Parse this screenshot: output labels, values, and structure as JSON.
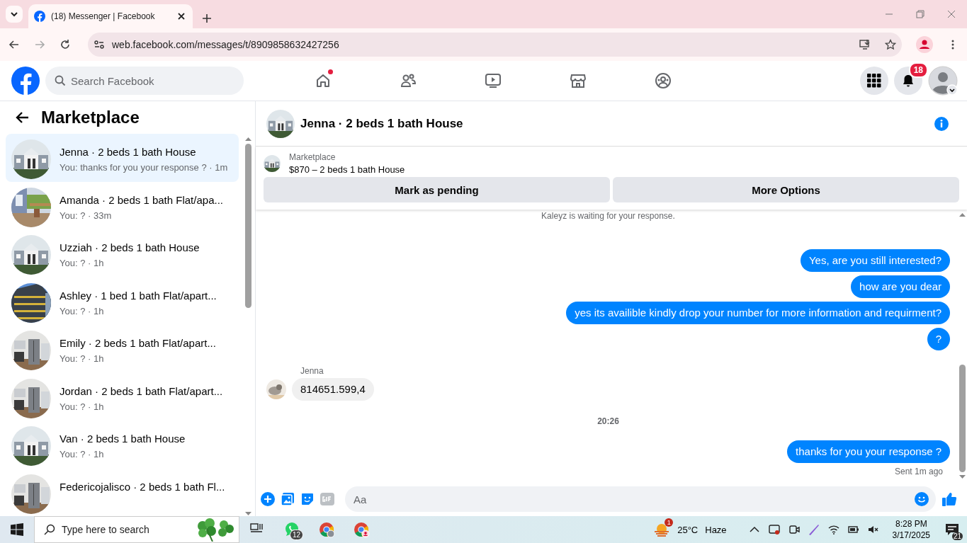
{
  "browser": {
    "tab": {
      "title": "(18) Messenger | Facebook"
    },
    "address": "web.facebook.com/messages/t/8909858632427256"
  },
  "topbar": {
    "search": {
      "placeholder": "Search Facebook"
    },
    "nav": [
      {
        "kind": "home",
        "dot": true
      },
      {
        "kind": "friends",
        "dot": false
      },
      {
        "kind": "video",
        "dot": false
      },
      {
        "kind": "marketplace",
        "dot": false
      },
      {
        "kind": "groups",
        "dot": false
      }
    ],
    "notification_count": "18"
  },
  "sidebar": {
    "title": "Marketplace",
    "conversations": [
      {
        "title": "Jenna · 2 beds 1 bath House",
        "preview": "You: thanks for you your response ? · 1m",
        "selected": true
      },
      {
        "title": "Amanda · 2 beds 1 bath Flat/apa...",
        "preview": "You: ? · 33m",
        "selected": false
      },
      {
        "title": "Uzziah · 2 beds 1 bath House",
        "preview": "You: ? · 1h",
        "selected": false
      },
      {
        "title": "Ashley · 1 bed 1 bath Flat/apart...",
        "preview": "You: ? · 1h",
        "selected": false
      },
      {
        "title": "Emily · 2 beds 1 bath Flat/apart...",
        "preview": "You: ? · 1h",
        "selected": false
      },
      {
        "title": "Jordan · 2 beds 1 bath Flat/apart...",
        "preview": "You: ? · 1h",
        "selected": false
      },
      {
        "title": "Van · 2 beds 1 bath House",
        "preview": "You: ? · 1h",
        "selected": false
      },
      {
        "title": "Federicojalisco · 2 beds 1 bath Fl...",
        "selected": false
      }
    ]
  },
  "chat": {
    "title": "Jenna · 2 beds 1 bath House",
    "listing": {
      "label": "Marketplace",
      "price": "$870 – 2 beds 1 bath House"
    },
    "buttons": [
      "Mark as pending",
      "More Options"
    ],
    "notice": "Kaleyz is waiting for your response.",
    "messages": [
      {
        "kind": "sent",
        "text": "Yes, are you still interested?"
      },
      {
        "kind": "sent",
        "text": "how are you dear"
      },
      {
        "kind": "sent",
        "text": "yes its availible kindly drop your number for more information and requirment?"
      },
      {
        "kind": "sent",
        "text": "?"
      },
      {
        "kind": "received",
        "sender": "Jenna",
        "text": "814651.599,4"
      },
      {
        "kind": "time",
        "text": "20:26"
      },
      {
        "kind": "sent",
        "text": "thanks for you your response ?"
      }
    ],
    "status": "Sent 1m ago",
    "composer": {
      "placeholder": "Aa"
    }
  },
  "taskbar": {
    "search": {
      "placeholder": "Type here to search"
    },
    "apps": [
      {
        "kind": "taskview"
      },
      {
        "kind": "whatsapp",
        "badge": "12"
      },
      {
        "kind": "chrome"
      },
      {
        "kind": "chrome-profile"
      }
    ],
    "weather": {
      "badge": "1",
      "temperature": "25°C",
      "condition": "Haze"
    },
    "time": "8:28 PM",
    "date": "3/17/2025",
    "notifications": "21"
  }
}
